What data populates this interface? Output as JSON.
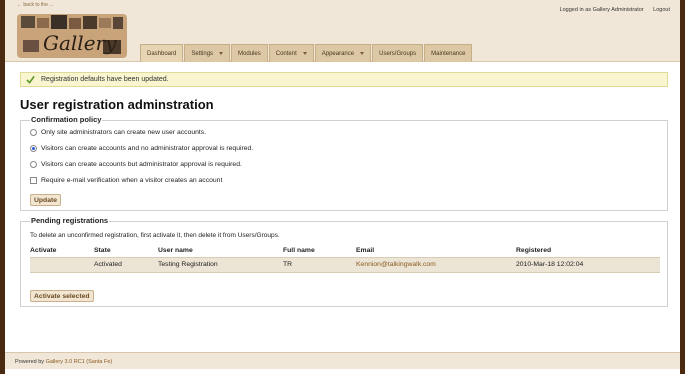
{
  "header": {
    "back_link": "← back to the ...",
    "logo_text": "Gallery",
    "logged_in_prefix": "Logged in as",
    "user_name": "Gallery Administrator",
    "logout": "Logout"
  },
  "nav": [
    {
      "label": "Dashboard",
      "dropdown": false
    },
    {
      "label": "Settings",
      "dropdown": true
    },
    {
      "label": "Modules",
      "dropdown": false
    },
    {
      "label": "Content",
      "dropdown": true
    },
    {
      "label": "Appearance",
      "dropdown": true
    },
    {
      "label": "Users/Groups",
      "dropdown": false
    },
    {
      "label": "Maintenance",
      "dropdown": false
    }
  ],
  "status_message": "Registration defaults have been updated.",
  "page_title": "User registration adminstration",
  "confirmation": {
    "legend": "Confirmation policy",
    "options": [
      {
        "label": "Only site administrators can create new user accounts.",
        "selected": false
      },
      {
        "label": "Visitors can create accounts and no administrator approval is required.",
        "selected": true
      },
      {
        "label": "Visitors can create accounts but administrator approval is required.",
        "selected": false
      }
    ],
    "email_verification": {
      "label": "Require e-mail verification when a visitor creates an account",
      "checked": false
    },
    "update_button": "Update"
  },
  "pending": {
    "legend": "Pending registrations",
    "description": "To delete an unconfirmed registration, first activate it, then delete it from Users/Groups.",
    "columns": [
      "Activate",
      "State",
      "User name",
      "Full name",
      "Email",
      "Registered"
    ],
    "rows": [
      {
        "activate": "",
        "state": "Activated",
        "user_name": "Testing Registration",
        "full_name": "TR",
        "email": "Kennion@talkingwalk.com",
        "registered": "2010-Mar-18 12:02:04"
      }
    ],
    "activate_button": "Activate selected"
  },
  "footer": {
    "prefix": "Powered by",
    "product": "Gallery 3.0 RC1 (Santa Fe)"
  },
  "colors": {
    "header_bg": "#f1e7d8",
    "nav_tab": "#dcc8a5",
    "status_bg": "#f8f5cf",
    "row_bg": "#ece4d4",
    "link": "#8a5a20",
    "check_green": "#5a9a2a"
  }
}
